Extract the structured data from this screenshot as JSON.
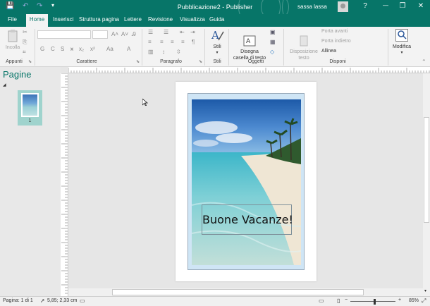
{
  "titlebar": {
    "title": "Pubblicazione2  -  Publisher",
    "user": "sassa lassa",
    "help": "?",
    "qat_save": "💾",
    "qat_undo": "↶",
    "qat_redo": "↷",
    "qat_more": "▾",
    "minimize": "—",
    "restore": "❐",
    "close": "✕",
    "ribbon_options": "▭"
  },
  "tabs": [
    "File",
    "Home",
    "Inserisci",
    "Struttura pagina",
    "Lettere",
    "Revisione",
    "Visualizza",
    "Guida"
  ],
  "ribbon": {
    "appunti": {
      "label": "Appunti",
      "paste": "Incolla"
    },
    "carattere": {
      "label": "Carattere",
      "bold": "G",
      "italic": "C",
      "underline": "S",
      "strike": "x",
      "subscript": "x₂",
      "superscript": "x²",
      "change_case": "Aa",
      "grow": "A˄",
      "shrink": "A˅",
      "font_color": "A",
      "clear": "Ꭿ"
    },
    "paragrafo": {
      "label": "Paragrafo",
      "pilcrow": "¶"
    },
    "stili": {
      "label": "Stili",
      "button": "Stili"
    },
    "oggetti": {
      "label": "Oggetti",
      "draw_textbox": "Disegna\ncasella di testo"
    },
    "disponi": {
      "label": "Disponi",
      "arrange": "Disposizione\ntesto",
      "bring_forward": "Porta avanti",
      "send_backward": "Porta indietro",
      "align": "Allinea"
    },
    "modifica": {
      "label": "Modifica",
      "button": "Modifica"
    }
  },
  "pages_pane": {
    "title": "Pagine",
    "collapse": "◢",
    "page_number": "1"
  },
  "document": {
    "caption": "Buone Vacanze!"
  },
  "status": {
    "page": "Pagina: 1 di 1",
    "position": "5,85; 2,33 cm",
    "zoom": "85%",
    "zoom_fraction": 0.53
  },
  "colors": {
    "accent": "#077568",
    "selection": "#9fd3cd"
  }
}
